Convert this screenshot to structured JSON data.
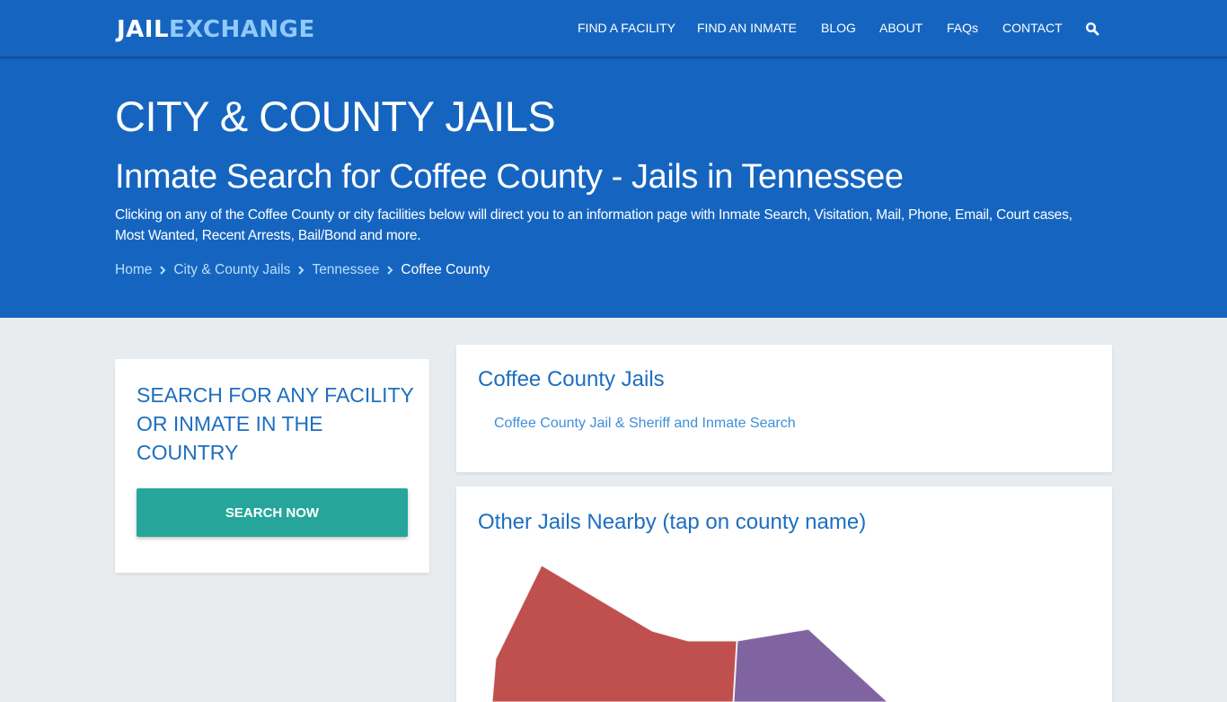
{
  "brand": {
    "logo_part1": "JAIL",
    "logo_part2": "EXCHANGE"
  },
  "nav": {
    "items": [
      {
        "label": "FIND A FACILITY"
      },
      {
        "label": "FIND AN INMATE"
      },
      {
        "label": "BLOG"
      },
      {
        "label": "ABOUT"
      },
      {
        "label": "FAQs"
      },
      {
        "label": "CONTACT"
      }
    ],
    "search_icon": "search-icon"
  },
  "hero": {
    "title": "CITY & COUNTY JAILS",
    "subtitle": "Inmate Search for Coffee County - Jails in Tennessee",
    "description": "Clicking on any of the Coffee County or city facilities below will direct you to an information page with Inmate Search, Visitation, Mail, Phone, Email, Court cases, Most Wanted, Recent Arrests, Bail/Bond and more."
  },
  "breadcrumb": {
    "items": [
      {
        "label": "Home"
      },
      {
        "label": "City & County Jails"
      },
      {
        "label": "Tennessee"
      },
      {
        "label": "Coffee County"
      }
    ],
    "separator_icon": "chevron-right-icon"
  },
  "sidebar": {
    "heading": "SEARCH FOR ANY FACILITY OR INMATE IN THE COUNTRY",
    "button_label": "SEARCH NOW"
  },
  "jails_card": {
    "heading": "Coffee County Jails",
    "links": [
      {
        "label": "Coffee County Jail & Sheriff and Inmate Search"
      }
    ]
  },
  "nearby_card": {
    "heading": "Other Jails Nearby (tap on county name)",
    "map_regions": [
      {
        "name": "county-region-red",
        "color": "#c0504d"
      },
      {
        "name": "county-region-purple",
        "color": "#8064a2"
      }
    ]
  },
  "colors": {
    "primary": "#1565c0",
    "accent": "#26a69a",
    "heading_blue": "#1e6ebf",
    "link_blue": "#3d8fd9",
    "page_bg": "#e9ecef"
  }
}
